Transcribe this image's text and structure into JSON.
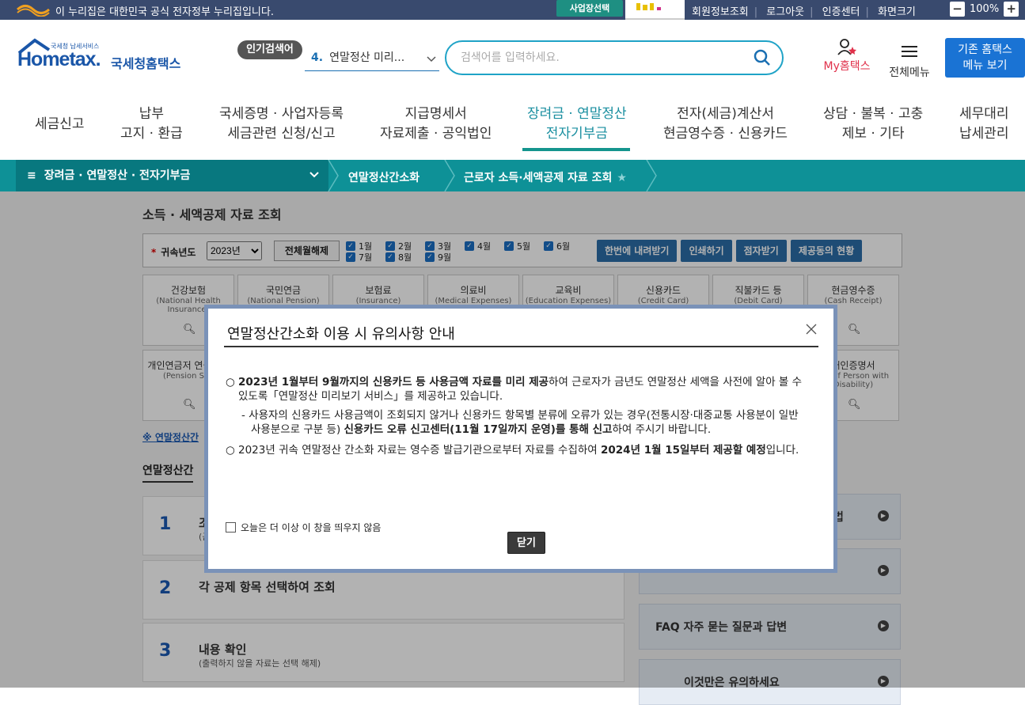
{
  "gov_banner": {
    "text": "이 누리집은 대한민국 공식 전자정부 누리집입니다.",
    "business_button": "사업장선택",
    "links": [
      "회원정보조회",
      "로그아웃",
      "인증센터",
      "화면크기"
    ],
    "zoom": "100%"
  },
  "header": {
    "logo_small": "국세청 납세서비스",
    "logo_main": "Hometax.",
    "logo_kr": "국세청홈택스",
    "popular_tag": "인기검색어",
    "popular_num": "4.",
    "popular_term": "연말정산 미리...",
    "search_placeholder": "검색어를 입력하세요.",
    "my_hometax": "My홈택스",
    "all_menu": "전체메뉴",
    "old_menu_line1": "기존 홈택스",
    "old_menu_line2": "메뉴 보기"
  },
  "gnb": [
    {
      "l1": "세금신고",
      "l2": ""
    },
    {
      "l1": "납부",
      "l2": "고지 · 환급"
    },
    {
      "l1": "국세증명 · 사업자등록",
      "l2": "세금관련 신청/신고"
    },
    {
      "l1": "지급명세서",
      "l2": "자료제출 · 공익법인"
    },
    {
      "l1": "장려금 · 연말정산",
      "l2": "전자기부금"
    },
    {
      "l1": "전자(세금)계산서",
      "l2": "현금영수증 · 신용카드"
    },
    {
      "l1": "상담 · 불복 · 고충",
      "l2": "제보 · 기타"
    },
    {
      "l1": "세무대리",
      "l2": "납세관리"
    }
  ],
  "breadcrumb": {
    "level1": "장려금 · 연말정산 · 전자기부금",
    "level2": "연말정산간소화",
    "level3": "근로자 소득·세액공제 자료 조회"
  },
  "page": {
    "title": "소득 · 세액공제 자료 조회",
    "year_label": "귀속년도",
    "year_value": "2023년",
    "cancel_all": "전체월해제",
    "months": [
      "1월",
      "2월",
      "3월",
      "4월",
      "5월",
      "6월",
      "7월",
      "8월",
      "9월"
    ],
    "buttons": [
      "한번에 내려받기",
      "인쇄하기",
      "점자받기",
      "제공동의 현황"
    ],
    "cards_row1": [
      {
        "kr": "건강보험",
        "en": "(National Health Insurance)"
      },
      {
        "kr": "국민연금",
        "en": "(National Pension)"
      },
      {
        "kr": "보험료",
        "en": "(Insurance)"
      },
      {
        "kr": "의료비",
        "en": "(Medical Expenses)"
      },
      {
        "kr": "교육비",
        "en": "(Education Expenses)"
      },
      {
        "kr": "신용카드",
        "en": "(Credit Card)"
      },
      {
        "kr": "직불카드 등",
        "en": "(Debit Card)"
      },
      {
        "kr": "현금영수증",
        "en": "(Cash Receipt)"
      }
    ],
    "cards_row2_left": {
      "kr": "개인연금저 연금계좌",
      "en": "(Pension Sav"
    },
    "cards_row2_right": {
      "kr": "애인증명서",
      "en": "ate of Person with Disability)"
    },
    "note": "※ 연말정산간",
    "section_title": "연말정산간",
    "steps": [
      {
        "num": "1",
        "title": "조",
        "sub": "(근"
      },
      {
        "num": "2",
        "title": "각 공제 항목 선택하여 조회",
        "sub": ""
      },
      {
        "num": "3",
        "title": "내용 확인",
        "sub": "(출력하지 않을 자료는 선택 해제)"
      }
    ],
    "right_boxes": [
      "법",
      "",
      "FAQ 자주 묻는 질문과 답변",
      "이것만은 유의하세요"
    ]
  },
  "modal": {
    "title": "연말정산간소화 이용 시 유의사항 안내",
    "para1_bold": "2023년 1월부터 9월까지의 신용카드 등 사용금액 자료를 미리 제공",
    "para1_rest": "하여 근로자가 금년도 연말정산 세액을 사전에 알아 볼 수 있도록「연말정산 미리보기 서비스」를 제공하고 있습니다.",
    "sub1_plain": "- 사용자의 신용카드 사용금액이 조회되지 않거나 신용카드 항목별 분류에 오류가 있는 경우(전통시장·대중교통 사용분이 일반 사용분으로 구분 등) ",
    "sub1_bold": "신용카드 오류 신고센터(11월 17일까지 운영)를 통해 신고",
    "sub1_end": "하여 주시기 바랍니다.",
    "para2_plain": "2023년 귀속 연말정산 간소화 자료는 영수증 발급기관으로부터 자료를 수집하여 ",
    "para2_bold": "2024년 1월 15일부터 제공할 예정",
    "para2_end": "입니다.",
    "bullet": "○",
    "checkbox_label": "오늘은 더 이상 이 창을 띄우지 않음",
    "close_button": "닫기"
  }
}
